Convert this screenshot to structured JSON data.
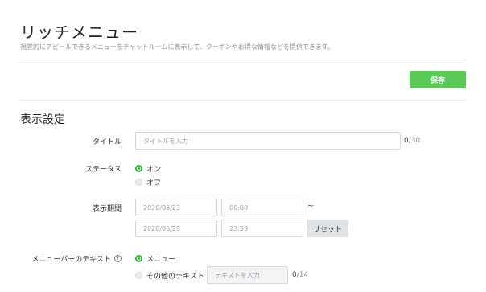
{
  "page": {
    "title": "リッチメニュー",
    "description": "視覚的にアピールできるメニューをチャットルームに表示して、クーポンやお得な情報などを提供できます。",
    "save_label": "保存"
  },
  "display_settings": {
    "section_title": "表示設定",
    "title_field": {
      "label": "タイトル",
      "placeholder": "タイトルを入力",
      "count": "0",
      "max": "/30"
    },
    "status": {
      "label": "ステータス",
      "options": [
        {
          "label": "オン",
          "selected": true
        },
        {
          "label": "オフ",
          "selected": false
        }
      ]
    },
    "period": {
      "label": "表示期間",
      "start_date": "2020/06/23",
      "start_time": "00:00",
      "separator": "~",
      "end_date": "2020/06/29",
      "end_time": "23:59",
      "reset_label": "リセット"
    },
    "menu_bar_text": {
      "label": "メニューバーのテキスト",
      "help_icon": "question-circle-icon",
      "options": [
        {
          "label": "メニュー",
          "selected": true
        },
        {
          "label": "その他のテキスト",
          "selected": false
        }
      ],
      "custom_placeholder": "テキストを入力",
      "count": "0",
      "max": "/14"
    }
  },
  "colors": {
    "accent": "#5ac95a",
    "radio_selected": "#2db82d"
  }
}
